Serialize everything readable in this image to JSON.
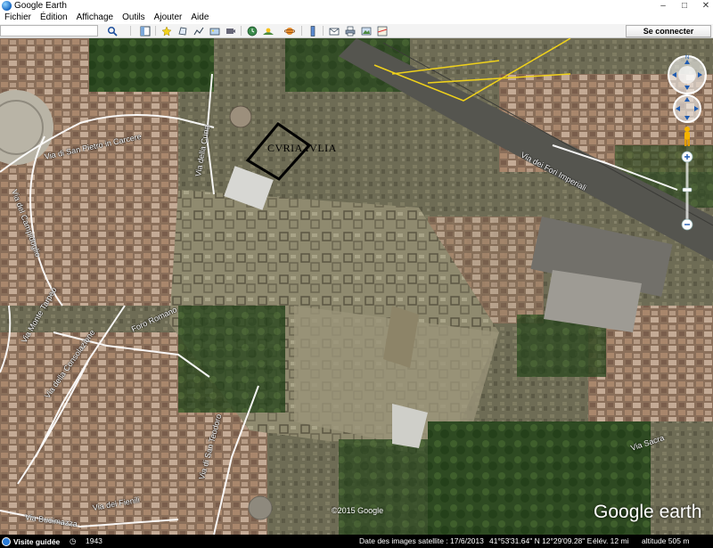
{
  "window": {
    "title": "Google Earth",
    "minimize": "–",
    "maximize": "□",
    "close": "✕"
  },
  "menu": [
    "Fichier",
    "Édition",
    "Affichage",
    "Outils",
    "Ajouter",
    "Aide"
  ],
  "search": {
    "value": "",
    "placeholder": ""
  },
  "toolbar": {
    "sign_in_label": "Se connecter",
    "tools": [
      "search-icon",
      "sidebar-icon",
      "placemark-icon",
      "polygon-icon",
      "path-icon",
      "image-overlay-icon",
      "tour-record-icon",
      "historical-imagery-icon",
      "sunlight-icon",
      "planets-icon",
      "ruler-icon",
      "email-icon",
      "print-icon",
      "save-image-icon"
    ]
  },
  "map": {
    "labels": {
      "curia": "CVRIA IVLIA",
      "via_san_pietro": "Via di San Pietro in Carcere",
      "via_curia": "Via della Curia",
      "via_fori_imperiali": "Via dei Fori Imperiali",
      "via_campidoglio": "Via del Campidoglio",
      "via_monte_tarpeo": "Via Monte Tarpeo",
      "via_consolazione": "Via della Consolazione",
      "foro_romano": "Foro Romano",
      "via_san_teodoro": "Via di San Teodoro",
      "via_fienili": "Via dei Fienili",
      "via_bucimazza": "Via Bucimazza",
      "via_sacra": "Via Sacra"
    },
    "copyright": "©2015 Google",
    "logo_google": "Google",
    "logo_earth": "earth"
  },
  "status": {
    "tour_label": "Visite guidée",
    "year": "1943",
    "imagery_date_label": "Date des images satellite : 17/6/2013",
    "coordinates": "41°53'31.64\" N   12°29'09.28\" E",
    "elevation": "élév.   12 mi",
    "eye_alt": "altitude   505 m"
  },
  "colors": {
    "highlight_outline": "#000000",
    "road_yellow": "#f0d21a"
  }
}
